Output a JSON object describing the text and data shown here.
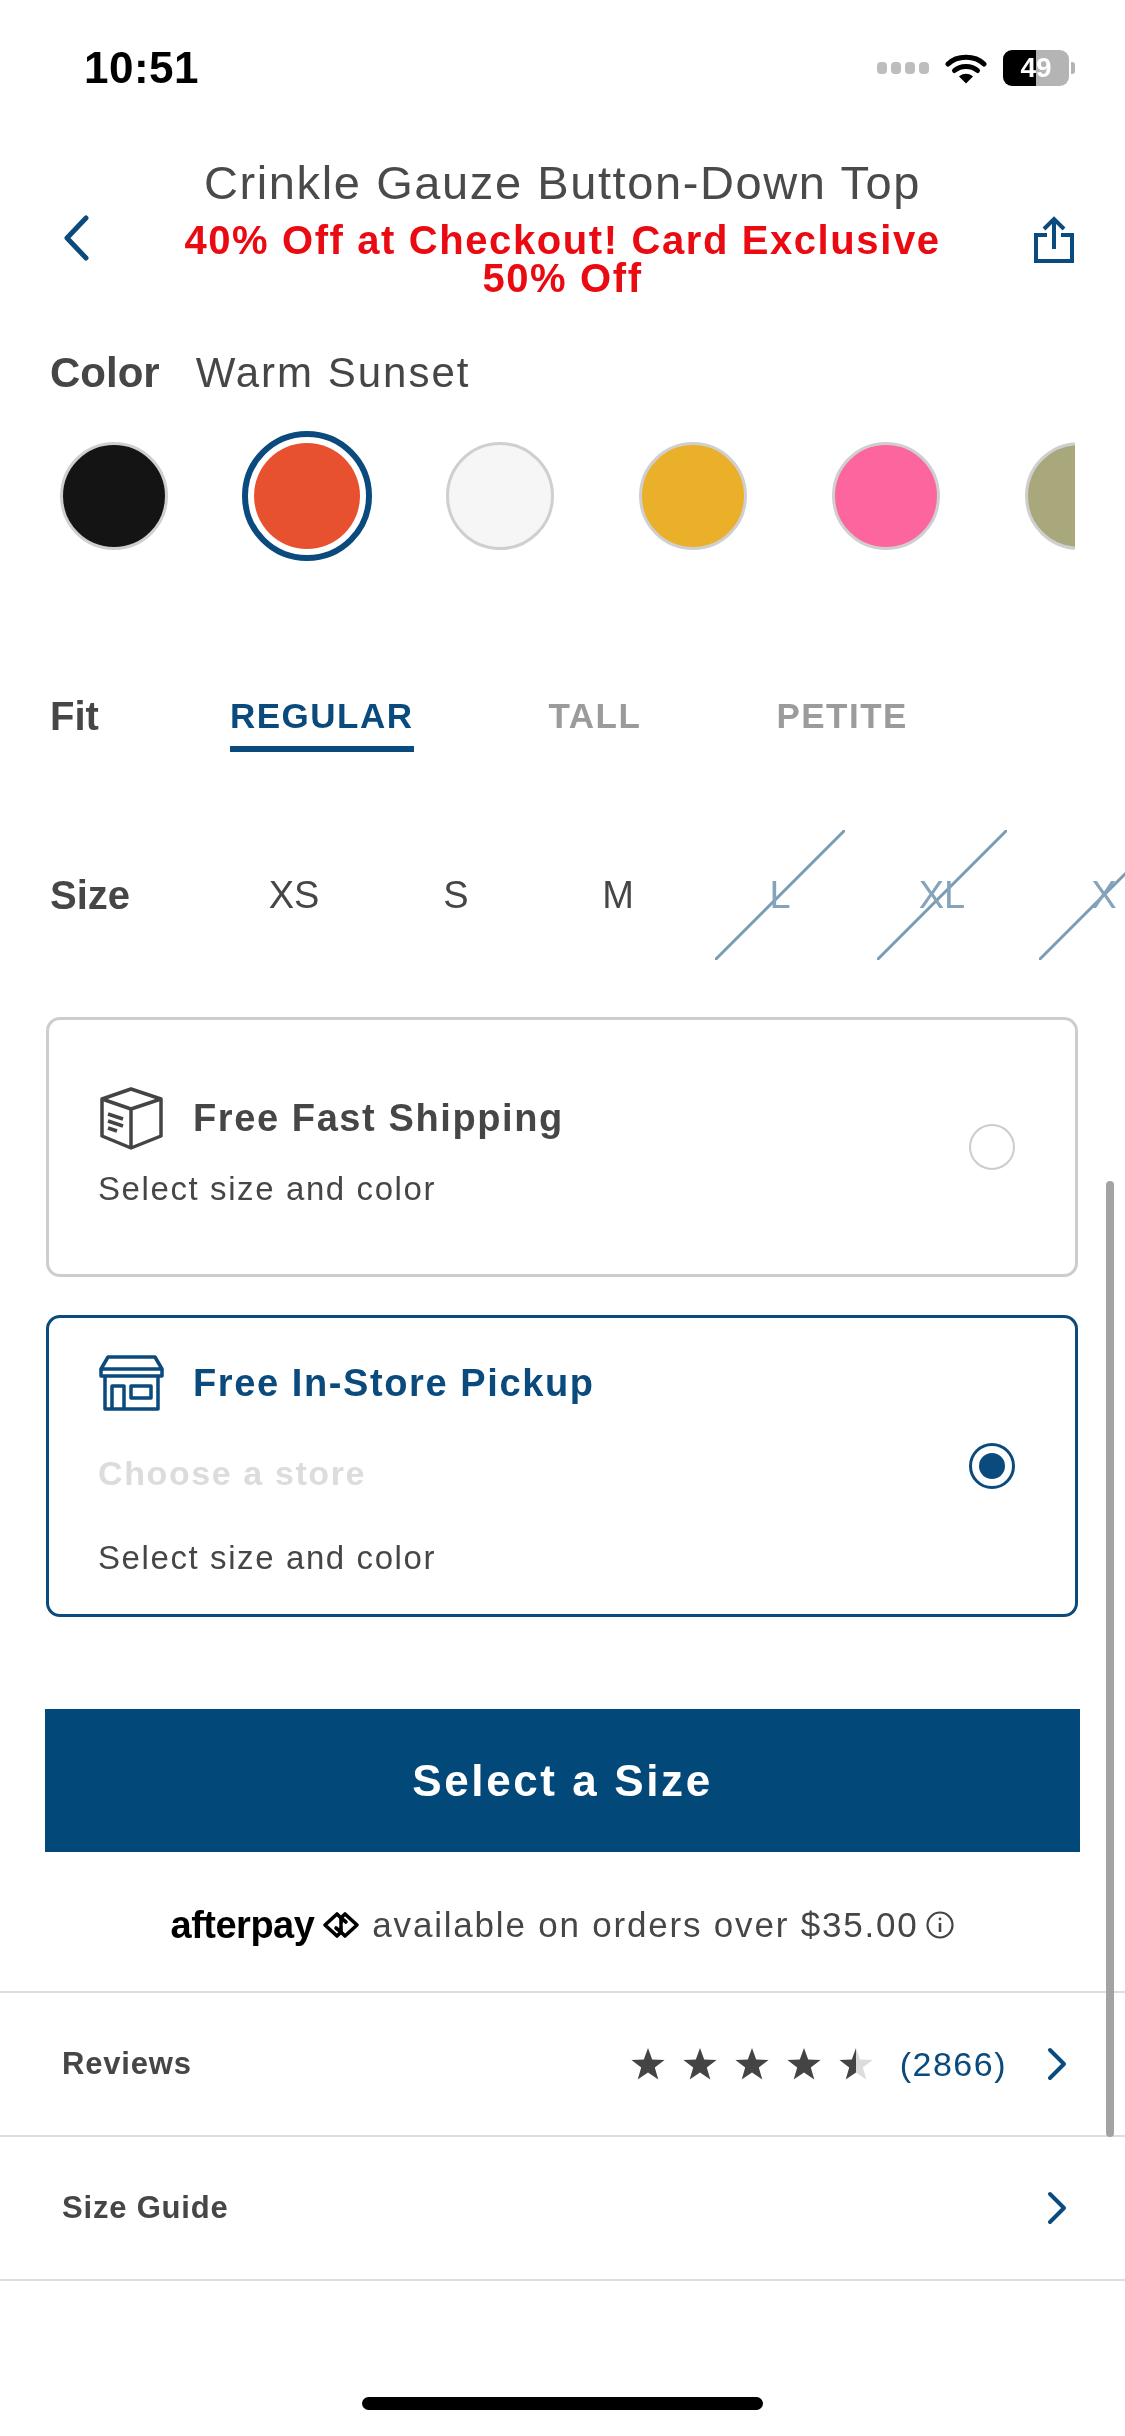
{
  "status_bar": {
    "time": "10:51",
    "battery": "49"
  },
  "header": {
    "title": "Crinkle Gauze Button-Down Top",
    "promo": "40% Off at Checkout! Card Exclusive 50% Off"
  },
  "color": {
    "label": "Color",
    "value": "Warm Sunset",
    "swatches": [
      {
        "color": "#141414",
        "selected": false
      },
      {
        "color": "#e8512f",
        "selected": true
      },
      {
        "color": "#f6f6f6",
        "selected": false
      },
      {
        "color": "#ebb029",
        "selected": false
      },
      {
        "color": "#fd659f",
        "selected": false
      },
      {
        "color": "#a9a77c",
        "selected": false
      }
    ]
  },
  "fit": {
    "label": "Fit",
    "tabs": [
      {
        "label": "REGULAR",
        "selected": true
      },
      {
        "label": "TALL",
        "selected": false
      },
      {
        "label": "PETITE",
        "selected": false
      }
    ]
  },
  "size": {
    "label": "Size",
    "options": [
      {
        "label": "XS",
        "available": true
      },
      {
        "label": "S",
        "available": true
      },
      {
        "label": "M",
        "available": true
      },
      {
        "label": "L",
        "available": false
      },
      {
        "label": "XL",
        "available": false
      },
      {
        "label": "X",
        "available": false
      }
    ]
  },
  "delivery": [
    {
      "kind": "shipping",
      "title": "Free Fast Shipping",
      "note": "Select size and color",
      "selected": false
    },
    {
      "kind": "pickup",
      "title": "Free In-Store Pickup",
      "store_link": {
        "label": "Choose a store",
        "disabled": true
      },
      "note": "Select size and color",
      "selected": true
    }
  ],
  "cta": {
    "label": "Select a Size"
  },
  "afterpay": {
    "logo": "afterpay",
    "text": "available on orders over $35.00"
  },
  "links": [
    {
      "kind": "reviews",
      "label": "Reviews",
      "stars": 4.5,
      "count": "(2866)"
    },
    {
      "kind": "plain",
      "label": "Size Guide"
    }
  ]
}
